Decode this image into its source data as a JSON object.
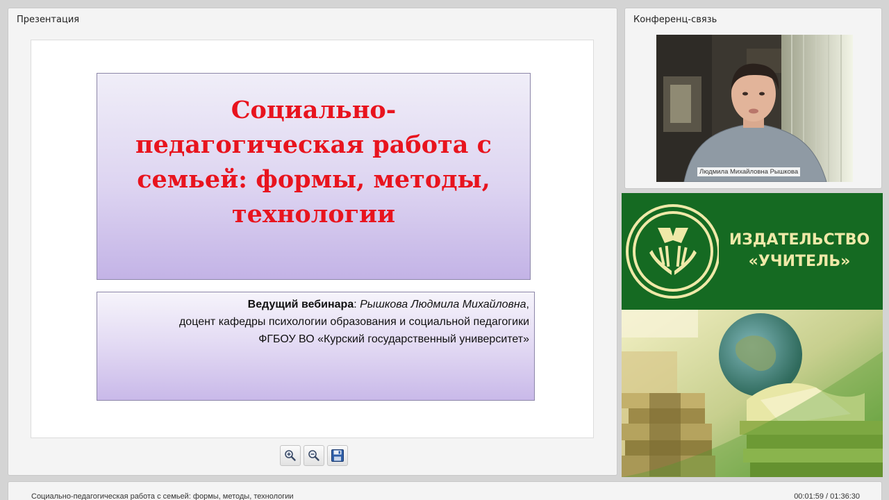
{
  "presentation": {
    "panel_title": "Презентация",
    "slide": {
      "title": "Социально-педагогическая работа с семьей: формы, методы, технологии",
      "host_label": "Ведущий вебинара",
      "host_separator": ": ",
      "host_name": "Рышкова Людмила Михайловна",
      "host_comma": ",",
      "host_position": "доцент кафедры психологии образования и социальной педагогики",
      "host_university": "ФГБОУ ВО «Курский государственный университет»"
    },
    "toolbar": {
      "zoom_in_icon": "zoom-in-icon",
      "zoom_out_icon": "zoom-out-icon",
      "save_icon": "save-icon"
    }
  },
  "conference": {
    "panel_title": "Конференц-связь",
    "video_caption": "Людмила Михайловна Рышкова"
  },
  "advertisement": {
    "publisher_line1": "ИЗДАТЕЛЬСТВО",
    "publisher_line2": "«УЧИТЕЛЬ»",
    "brand_colors": {
      "background": "#156a22",
      "text": "#efe9a8"
    }
  },
  "statusbar": {
    "title": "Социально-педагогическая работа с семьей: формы, методы, технологии",
    "time": "00:01:59 / 01:36:30"
  }
}
